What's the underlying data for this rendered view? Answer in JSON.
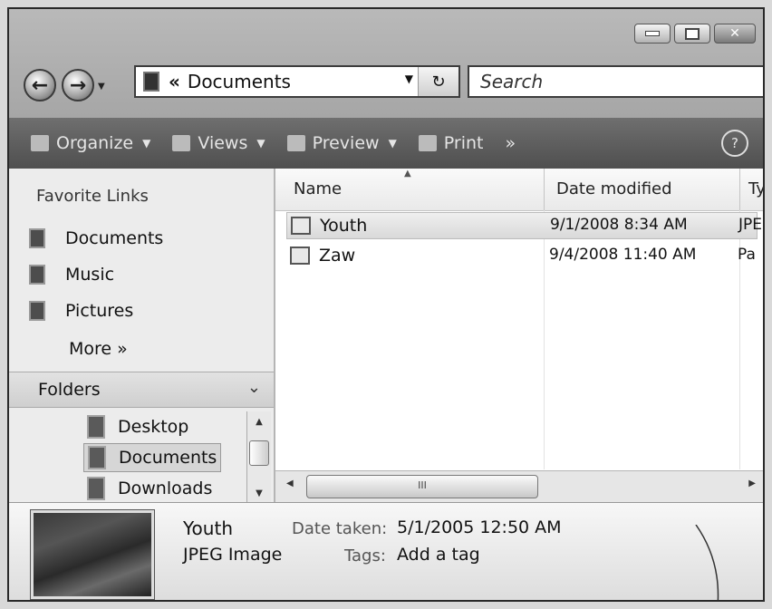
{
  "address_bar": {
    "path": "Documents",
    "chevron": "«"
  },
  "search": {
    "placeholder": "Search"
  },
  "toolbar": {
    "organize": "Organize",
    "views": "Views",
    "preview": "Preview",
    "print": "Print",
    "overflow": "»",
    "help": "?"
  },
  "favorites": {
    "header": "Favorite Links",
    "items": [
      {
        "label": "Documents",
        "icon": "documents-icon"
      },
      {
        "label": "Music",
        "icon": "music-icon"
      },
      {
        "label": "Pictures",
        "icon": "pictures-icon"
      }
    ],
    "more": "More »"
  },
  "folders": {
    "header": "Folders",
    "items": [
      {
        "label": "Desktop",
        "selected": false
      },
      {
        "label": "Documents",
        "selected": true
      },
      {
        "label": "Downloads",
        "selected": false
      }
    ]
  },
  "columns": {
    "name": "Name",
    "date": "Date modified",
    "type": "Ty"
  },
  "files": [
    {
      "name": "Youth",
      "date": "9/1/2008 8:34 AM",
      "type": "JPE",
      "selected": true
    },
    {
      "name": "Zaw",
      "date": "9/4/2008 11:40 AM",
      "type": "Pa",
      "selected": false
    }
  ],
  "scrollbar": {
    "grip": "III"
  },
  "details": {
    "name": "Youth",
    "type": "JPEG Image",
    "date_taken_label": "Date taken:",
    "date_taken": "5/1/2005 12:50 AM",
    "tags_label": "Tags:",
    "tags_value": "Add a tag"
  }
}
